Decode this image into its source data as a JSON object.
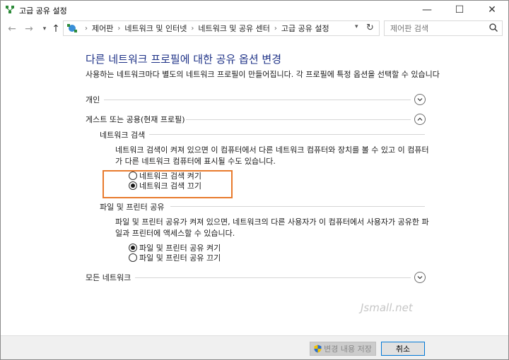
{
  "window": {
    "title": "고급 공유 설정",
    "controls": {
      "minimize": "—",
      "maximize": "☐",
      "close": "✕"
    }
  },
  "nav": {
    "back_icon": "←",
    "forward_icon": "→",
    "recent_icon": "▾",
    "up_icon": "↑",
    "breadcrumbs": [
      "제어판",
      "네트워크 및 인터넷",
      "네트워크 및 공유 센터",
      "고급 공유 설정"
    ],
    "separator": "›",
    "dropdown_icon": "▾",
    "refresh_icon": "↻",
    "search_placeholder": "제어판 검색"
  },
  "main": {
    "title": "다른 네트워크 프로필에 대한 공유 옵션 변경",
    "description": "사용하는 네트워크마다 별도의 네트워크 프로필이 만들어집니다. 각 프로필에 특정 옵션을 선택할 수 있습니다",
    "profiles": {
      "private": {
        "label": "개인",
        "state": "collapsed"
      },
      "guest": {
        "label": "게스트 또는 공용(현재 프로필)",
        "state": "expanded"
      },
      "all": {
        "label": "모든 네트워크",
        "state": "collapsed"
      }
    },
    "network_discovery": {
      "heading": "네트워크 검색",
      "line1": "네트워크 검색이 켜져 있으면 이 컴퓨터에서 다른 네트워크 컴퓨터와 장치를 볼 수 있고 이 컴퓨터",
      "line2": "가 다른 네트워크 컴퓨터에 표시될 수도 있습니다.",
      "options": [
        {
          "label": "네트워크 검색 켜기",
          "selected": false
        },
        {
          "label": "네트워크 검색 끄기",
          "selected": true
        }
      ]
    },
    "file_sharing": {
      "heading": "파일 및 프린터 공유",
      "line1": "파일 및 프린터 공유가 켜져 있으면, 네트워크의 다른 사용자가 이 컴퓨터에서 사용자가 공유한 파",
      "line2": "일과 프린터에 액세스할 수 있습니다.",
      "options": [
        {
          "label": "파일 및 프린터 공유 켜기",
          "selected": true
        },
        {
          "label": "파일 및 프린터 공유 끄기",
          "selected": false
        }
      ]
    },
    "watermark": "Jsmall.net"
  },
  "footer": {
    "save_label": "변경 내용 저장",
    "cancel_label": "취소"
  },
  "colors": {
    "title": "#1e3287",
    "highlight": "#e87a2c",
    "cancel_border": "#0078d7"
  }
}
